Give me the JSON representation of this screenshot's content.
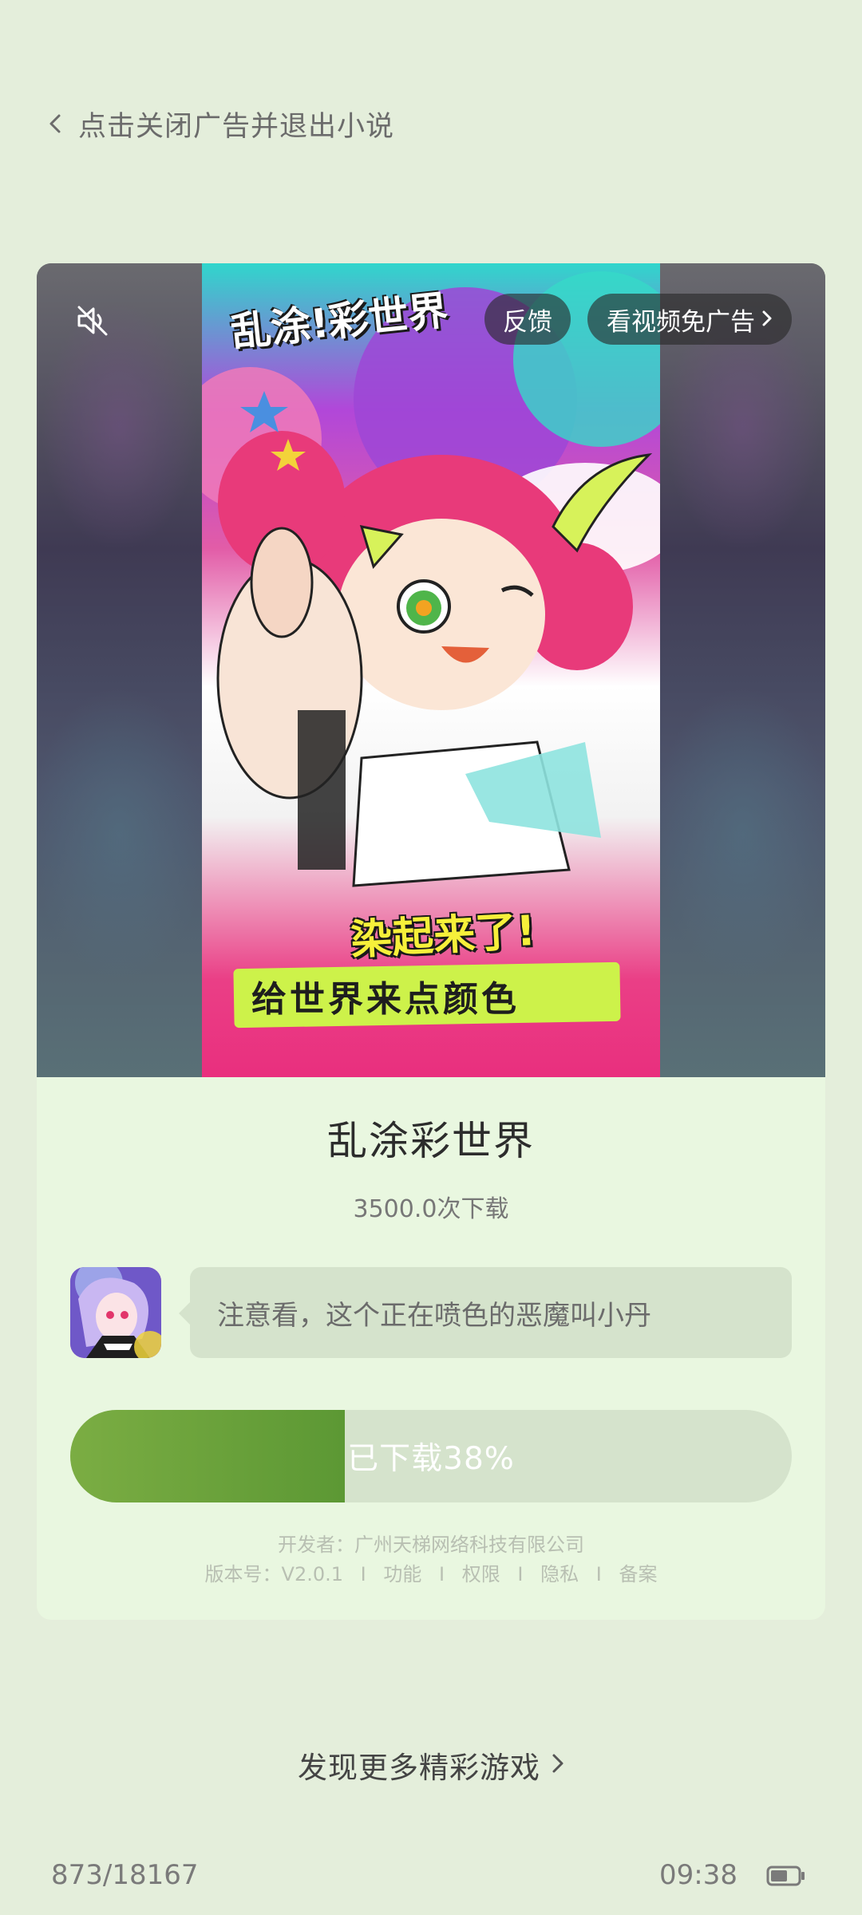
{
  "header": {
    "back_label": "点击关闭广告并退出小说"
  },
  "ad": {
    "media": {
      "poster_logo": "乱涂!彩世界",
      "poster_slogan_1": "染起来了!",
      "poster_slogan_2": "给世界来点颜色"
    },
    "feedback_label": "反馈",
    "no_ad_label": "看视频免广告",
    "app_name": "乱涂彩世界",
    "downloads": "3500.0次下载",
    "bubble_text": "注意看，这个正在喷色的恶魔叫小丹",
    "progress": {
      "label": "已下载38%",
      "percent": 38,
      "fill_color": "#6aa33b",
      "track_color": "#d5e3cc"
    },
    "meta": {
      "developer": "开发者：广州天梯网络科技有限公司",
      "version": "版本号：V2.0.1",
      "links": [
        "功能",
        "权限",
        "隐私",
        "备案"
      ]
    }
  },
  "discover": {
    "label": "发现更多精彩游戏"
  },
  "status": {
    "page_count": "873/18167",
    "time": "09:38"
  },
  "icons": {
    "back": "chevron-left-icon",
    "mute": "speaker-muted-icon",
    "no_ad_arrow": "chevron-right-icon",
    "discover_arrow": "chevron-right-icon",
    "battery": "battery-icon"
  },
  "colors": {
    "background": "#e4eedb",
    "card": "#e9f7e0",
    "accent": "#6aa33b"
  }
}
